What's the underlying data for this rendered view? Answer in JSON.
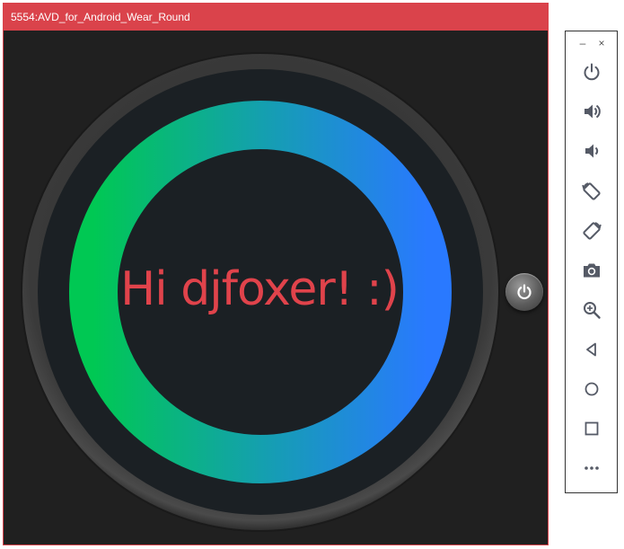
{
  "window": {
    "title": "5554:AVD_for_Android_Wear_Round"
  },
  "screen": {
    "greeting": "Hi djfoxer! :)"
  },
  "colors": {
    "titlebar": "#da434b",
    "greeting": "#e0434b",
    "ring_start": "#00c853",
    "ring_end": "#2979ff",
    "screen_bg": "#1b2024",
    "bezel": "#3c3c3c"
  },
  "toolbar": {
    "minimize_label": "–",
    "close_label": "×",
    "buttons": [
      {
        "name": "power-icon"
      },
      {
        "name": "volume-up-icon"
      },
      {
        "name": "volume-down-icon"
      },
      {
        "name": "rotate-left-icon"
      },
      {
        "name": "rotate-right-icon"
      },
      {
        "name": "camera-icon"
      },
      {
        "name": "zoom-icon"
      },
      {
        "name": "back-icon"
      },
      {
        "name": "home-icon"
      },
      {
        "name": "overview-icon"
      },
      {
        "name": "more-icon"
      }
    ]
  }
}
